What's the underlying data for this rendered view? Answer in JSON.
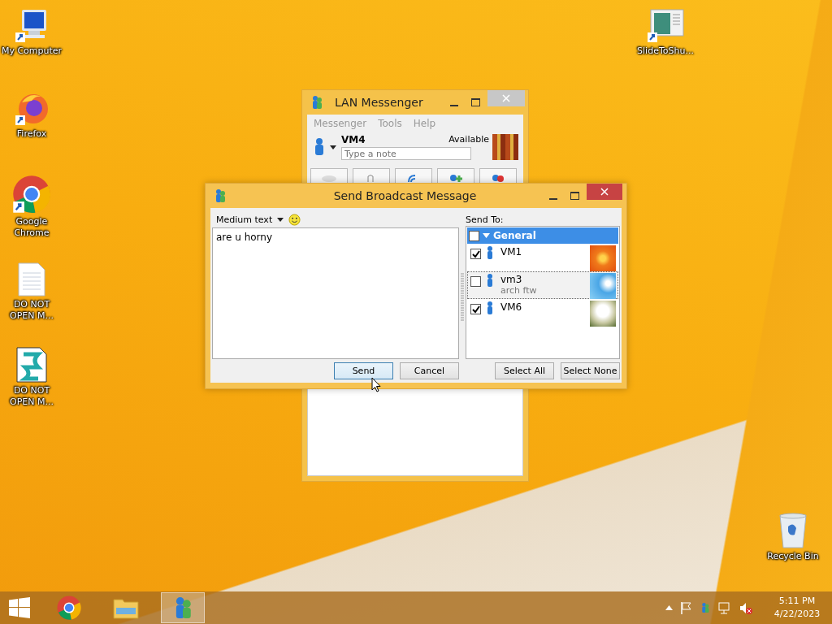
{
  "desktop_icons": [
    {
      "label": "My Computer",
      "kind": "computer"
    },
    {
      "label": "Firefox",
      "kind": "firefox"
    },
    {
      "label": "Google Chrome",
      "kind": "chrome"
    },
    {
      "label": "DO NOT OPEN M...",
      "kind": "text"
    },
    {
      "label": "DO NOT OPEN M...",
      "kind": "script"
    },
    {
      "label": "SlideToShu...",
      "kind": "slide"
    },
    {
      "label": "Recycle Bin",
      "kind": "recycle"
    }
  ],
  "messenger_window": {
    "title": "LAN Messenger",
    "menu": [
      "Messenger",
      "Tools",
      "Help"
    ],
    "user_name": "VM4",
    "status": "Available",
    "note": {
      "placeholder": "Type a note"
    }
  },
  "broadcast_dialog": {
    "title": "Send Broadcast Message",
    "font_size": "Medium text",
    "message": "are u horny",
    "send_to_label": "Send To:",
    "group": {
      "name": "General",
      "checked": false
    },
    "contacts": [
      {
        "name": "VM1",
        "checked": true,
        "selected": false
      },
      {
        "name": "vm3",
        "note": "arch ftw",
        "checked": false,
        "selected": true
      },
      {
        "name": "VM6",
        "checked": true,
        "selected": false
      }
    ],
    "buttons": [
      "Send",
      "Cancel"
    ],
    "list_buttons": [
      "Select All",
      "Select None"
    ]
  },
  "taskbar": {
    "apps": [
      {
        "kind": "chrome",
        "active": false
      },
      {
        "kind": "folder",
        "active": false
      },
      {
        "kind": "messenger",
        "active": true
      }
    ],
    "time": "5:11 PM",
    "date": "4/22/2023"
  }
}
